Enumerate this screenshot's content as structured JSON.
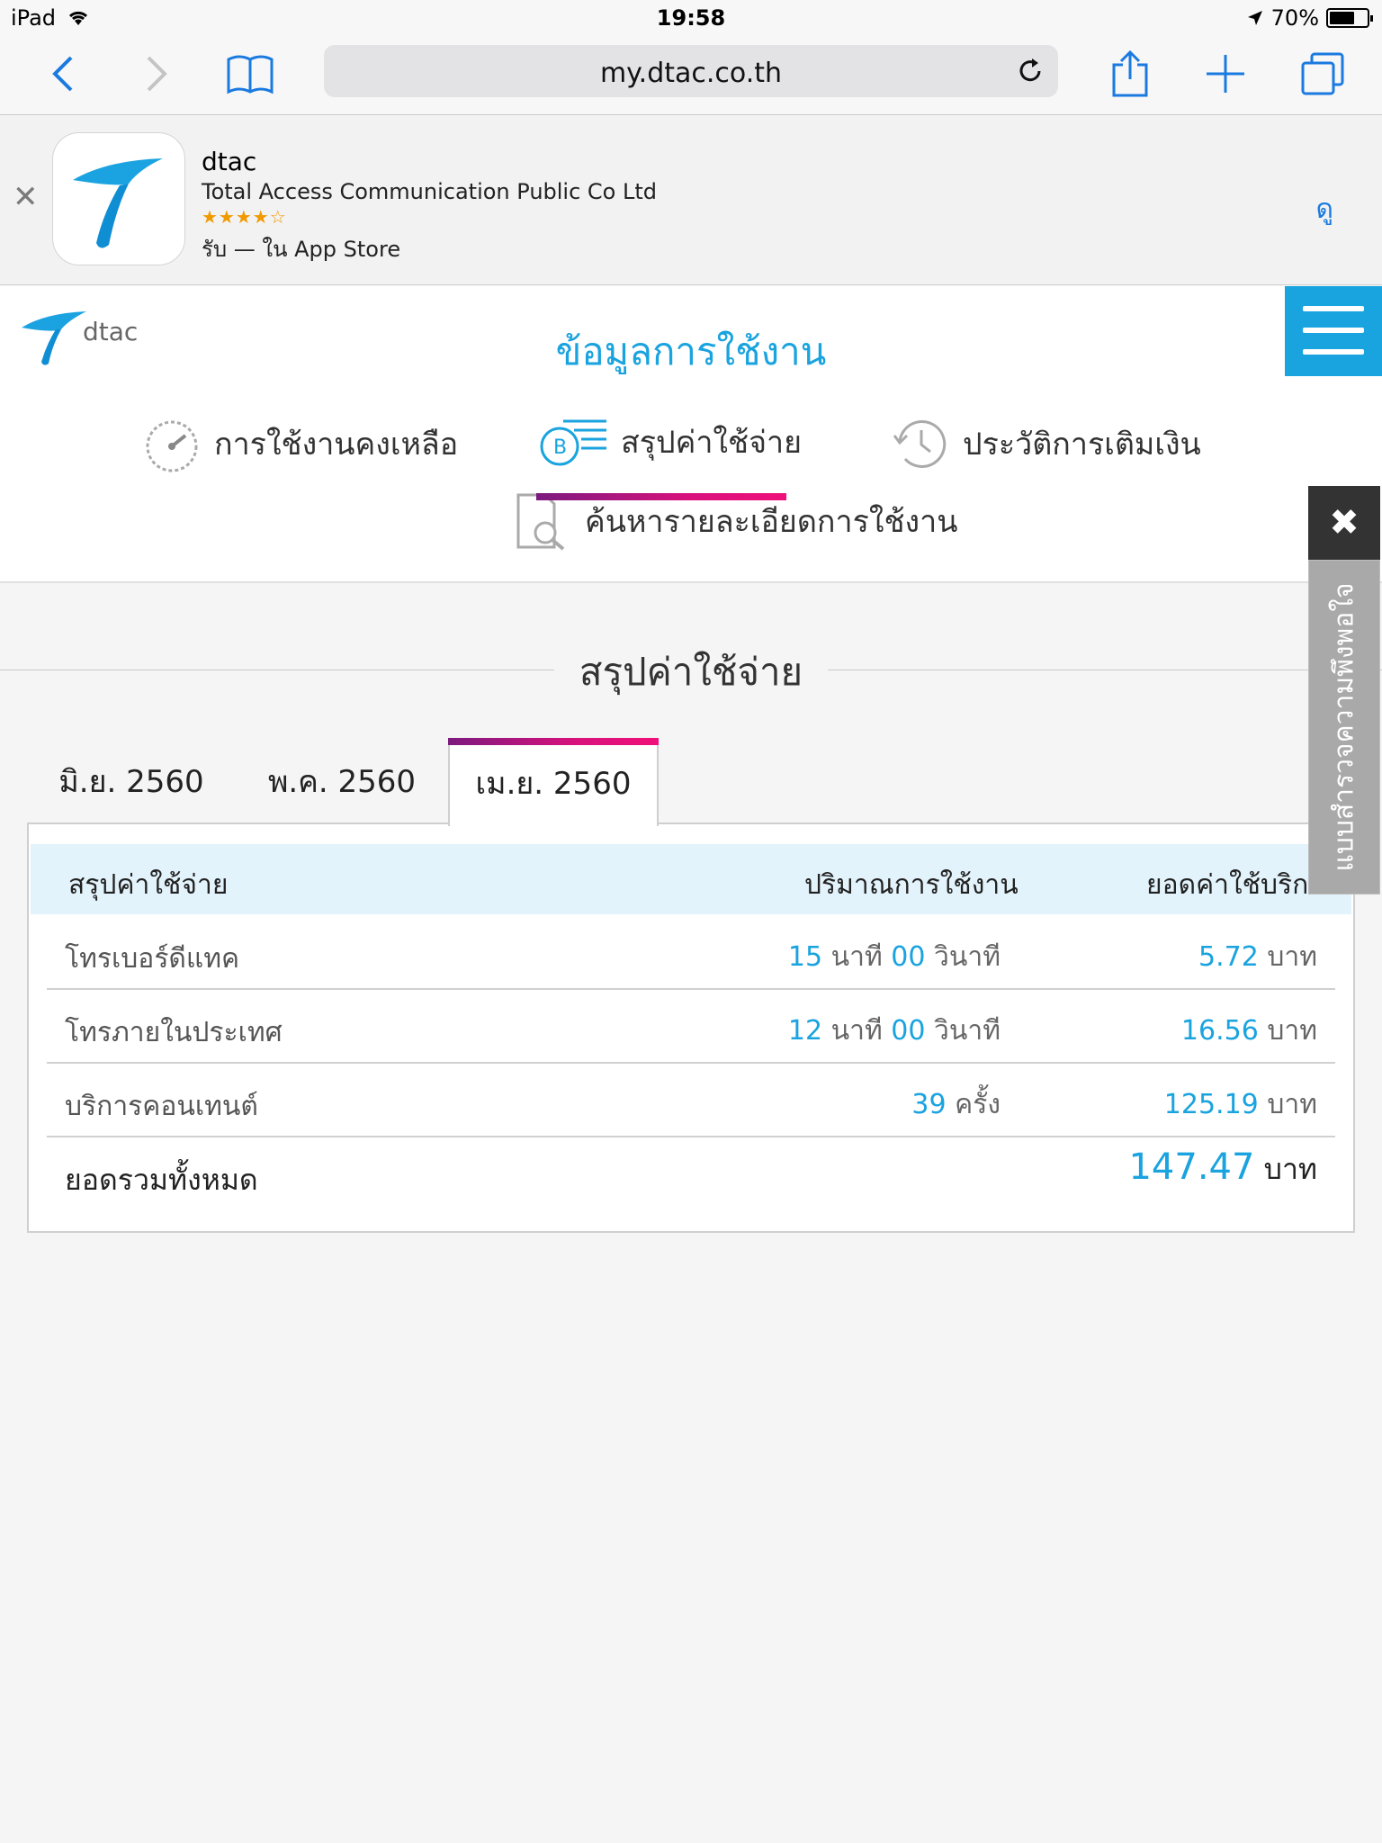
{
  "status_bar": {
    "device": "iPad",
    "time": "19:58",
    "battery": "70%",
    "battery_level": 0.7
  },
  "browser": {
    "url": "my.dtac.co.th"
  },
  "app_banner": {
    "app_name": "dtac",
    "company": "Total Access Communication Public Co Ltd",
    "rating_stars": "★★★★☆",
    "store_text": "รับ — ใน App Store",
    "view_button": "ดู"
  },
  "site": {
    "logo_text": "dtac",
    "page_title": "ข้อมูลการใช้งาน",
    "nav": [
      {
        "label": "การใช้งานคงเหลือ",
        "icon": "gauge-icon"
      },
      {
        "label": "สรุปค่าใช้จ่าย",
        "icon": "bill-coin-icon",
        "active": true
      },
      {
        "label": "ประวัติการเติมเงิน",
        "icon": "history-clock-icon"
      },
      {
        "label": "ค้นหารายละเอียดการใช้งาน",
        "icon": "document-search-icon"
      }
    ],
    "accent_color": "#19a3df",
    "active_gradient": [
      "#7c1a7e",
      "#f0107a"
    ]
  },
  "summary": {
    "section_title": "สรุปค่าใช้จ่าย",
    "month_tabs": [
      "มิ.ย. 2560",
      "พ.ค. 2560",
      "เม.ย. 2560"
    ],
    "active_month": "เม.ย. 2560",
    "table": {
      "headers": [
        "สรุปค่าใช้จ่าย",
        "ปริมาณการใช้งาน",
        "ยอดค่าใช้บริการ"
      ],
      "rows": [
        {
          "label": "โทรเบอร์ดีแทค",
          "usage_minutes": "15",
          "minutes_unit": "นาที",
          "usage_seconds": "00",
          "seconds_unit": "วินาที",
          "cost": "5.72",
          "cost_unit": "บาท"
        },
        {
          "label": "โทรภายในประเทศ",
          "usage_minutes": "12",
          "minutes_unit": "นาที",
          "usage_seconds": "00",
          "seconds_unit": "วินาที",
          "cost": "16.56",
          "cost_unit": "บาท"
        },
        {
          "label": "บริการคอนเทนต์",
          "usage_count": "39",
          "count_unit": "ครั้ง",
          "cost": "125.19",
          "cost_unit": "บาท"
        }
      ],
      "total": {
        "label": "ยอดรวมทั้งหมด",
        "cost": "147.47",
        "cost_unit": "บาท"
      }
    }
  },
  "feedback_tab": {
    "close_label": "✖",
    "text": "แบบสำรวจความพึงพอใจ"
  }
}
